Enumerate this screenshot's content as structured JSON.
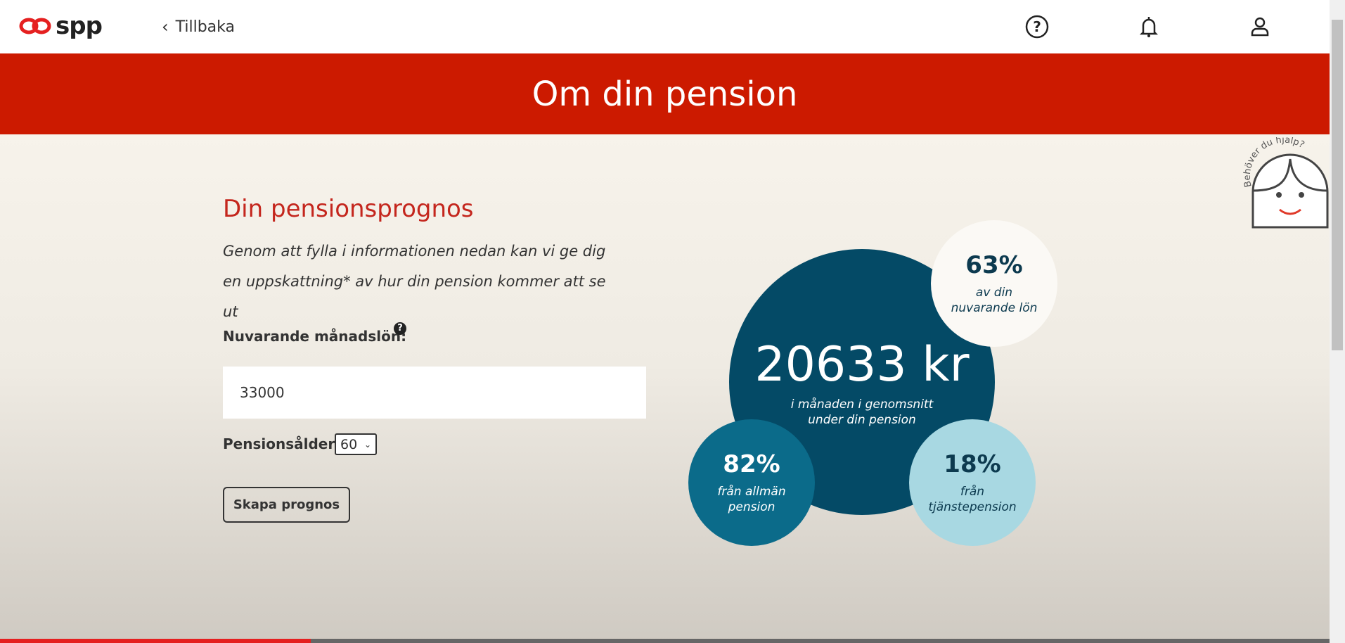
{
  "header": {
    "logo": "spp",
    "back_label": "Tillbaka",
    "icons": [
      "help-icon",
      "bell-icon",
      "user-icon"
    ]
  },
  "banner": {
    "title": "Om din pension"
  },
  "form": {
    "heading": "Din pensionsprognos",
    "intro": "Genom att fylla i informationen nedan kan vi ge dig en uppskattning* av hur din pension kommer att se ut",
    "salary_label": "Nuvarande månadslön:",
    "salary_help": "?",
    "salary_value": "33000",
    "age_label": "Pensionsålder",
    "age_value": "60",
    "submit_label": "Skapa prognos"
  },
  "result": {
    "amount": "20633 kr",
    "amount_desc": "i månaden i genomsnitt under din pension",
    "share_of_salary": "63%",
    "share_of_salary_desc": "av din nuvarande lön",
    "public_pct": "82%",
    "public_desc": "från allmän pension",
    "occupational_pct": "18%",
    "occupational_desc": "från tjänstepension"
  },
  "help_widget": {
    "text": "Behöver du hjälp?"
  },
  "colors": {
    "brand_red": "#cc1a00",
    "dark_teal": "#044a66",
    "mid_teal": "#0b6b8a",
    "light_teal": "#a8d8e2"
  },
  "video_progress_percent": 23.4
}
